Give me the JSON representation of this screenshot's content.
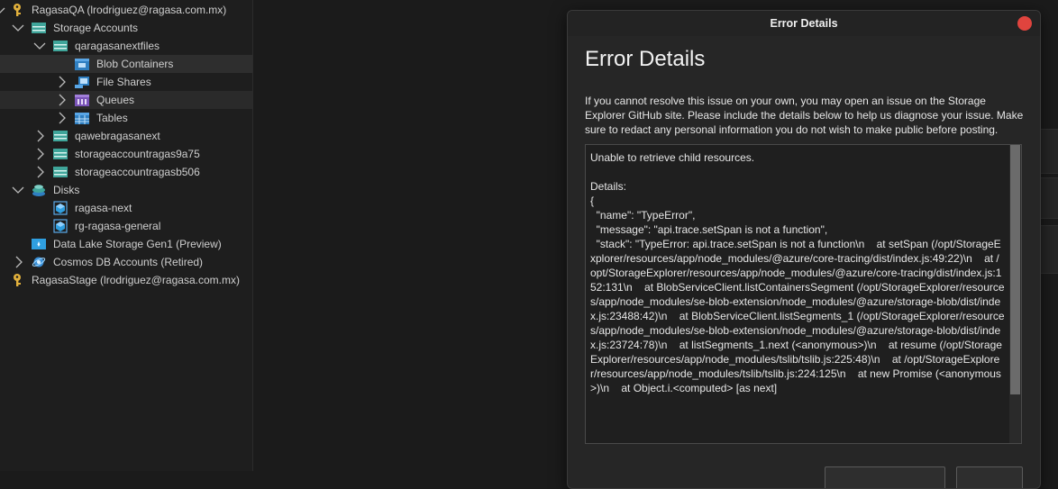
{
  "tree": {
    "account_qa": "RagasaQA (lrodriguez@ragasa.com.mx)",
    "storage_accounts": "Storage Accounts",
    "qaragasanextfiles": "qaragasanextfiles",
    "blob_containers": "Blob Containers",
    "file_shares": "File Shares",
    "queues": "Queues",
    "tables": "Tables",
    "qawebragasanext": "qawebragasanext",
    "storageaccountragas9a75": "storageaccountragas9a75",
    "storageaccountragasb506": "storageaccountragasb506",
    "disks": "Disks",
    "ragasa_next": "ragasa-next",
    "rg_ragasa_general": "rg-ragasa-general",
    "data_lake": "Data Lake Storage Gen1 (Preview)",
    "cosmos": "Cosmos DB Accounts (Retired)",
    "account_stage": "RagasaStage (lrodriguez@ragasa.com.mx)"
  },
  "dialog": {
    "window_title": "Error Details",
    "heading": "Error Details",
    "description": "If you cannot resolve this issue on your own, you may open an issue on the Storage Explorer GitHub site. Please include the details below to help us diagnose your issue. Make sure to redact any personal information you do not wish to make public before posting.",
    "details": "Unable to retrieve child resources.\n\nDetails:\n{\n  \"name\": \"TypeError\",\n  \"message\": \"api.trace.setSpan is not a function\",\n  \"stack\": \"TypeError: api.trace.setSpan is not a function\\n    at setSpan (/opt/StorageExplorer/resources/app/node_modules/@azure/core-tracing/dist/index.js:49:22)\\n    at /opt/StorageExplorer/resources/app/node_modules/@azure/core-tracing/dist/index.js:152:131\\n    at BlobServiceClient.listContainersSegment (/opt/StorageExplorer/resources/app/node_modules/se-blob-extension/node_modules/@azure/storage-blob/dist/index.js:23488:42)\\n    at BlobServiceClient.listSegments_1 (/opt/StorageExplorer/resources/app/node_modules/se-blob-extension/node_modules/@azure/storage-blob/dist/index.js:23724:78)\\n    at listSegments_1.next (<anonymous>)\\n    at resume (/opt/StorageExplorer/resources/app/node_modules/tslib/tslib.js:225:48)\\n    at /opt/StorageExplorer/resources/app/node_modules/tslib/tslib.js:224:125\\n    at new Promise (<anonymous>)\\n    at Object.i.<computed> [as next]"
  }
}
